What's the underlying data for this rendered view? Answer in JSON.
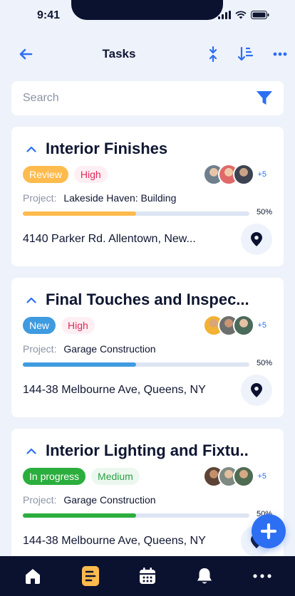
{
  "status_bar": {
    "time": "9:41"
  },
  "header": {
    "title": "Tasks",
    "icons": {
      "back": "arrow-left-icon",
      "collapse": "collapse-icon",
      "sort": "sort-icon",
      "more": "more-dots-icon"
    }
  },
  "search": {
    "placeholder": "Search",
    "value": ""
  },
  "colors": {
    "accent": "#2d6ff2",
    "dark": "#0b1230"
  },
  "tasks": [
    {
      "title": "Interior Finishes",
      "status": {
        "label": "Review",
        "bg": "#ffbb4d",
        "color": "#ffffff"
      },
      "priority": {
        "label": "High",
        "bg": "#fdeff3",
        "color": "#e2285a"
      },
      "project_label": "Project:",
      "project": "Lakeside Haven: Building",
      "progress": 0.5,
      "progress_label": "50%",
      "progress_color": "#ffbb4d",
      "extra_assignees": "+5",
      "address": "4140 Parker Rd. Allentown, New..."
    },
    {
      "title": "Final Touches and Inspec...",
      "status": {
        "label": "New",
        "bg": "#3f9be0",
        "color": "#ffffff"
      },
      "priority": {
        "label": "High",
        "bg": "#fdeff3",
        "color": "#e2285a"
      },
      "project_label": "Project:",
      "project": "Garage Construction",
      "progress": 0.5,
      "progress_label": "50%",
      "progress_color": "#3f9be0",
      "extra_assignees": "+5",
      "address": "144-38 Melbourne Ave, Queens, NY"
    },
    {
      "title": "Interior Lighting and Fixtu..",
      "status": {
        "label": "In progress",
        "bg": "#2bae3d",
        "color": "#ffffff"
      },
      "priority": {
        "label": "Medium",
        "bg": "#ecf8ef",
        "color": "#2ba048"
      },
      "project_label": "Project:",
      "project": "Garage Construction",
      "progress": 0.5,
      "progress_label": "50%",
      "progress_color": "#2bae3d",
      "extra_assignees": "+5",
      "address": "144-38 Melbourne Ave, Queens, NY"
    }
  ],
  "fab": {
    "icon": "plus-icon"
  },
  "bottom_nav": {
    "items": [
      {
        "icon": "home-icon",
        "active": false
      },
      {
        "icon": "tasks-icon",
        "active": true
      },
      {
        "icon": "calendar-icon",
        "active": false
      },
      {
        "icon": "bell-icon",
        "active": false
      },
      {
        "icon": "more-dots-icon",
        "active": false
      }
    ]
  }
}
